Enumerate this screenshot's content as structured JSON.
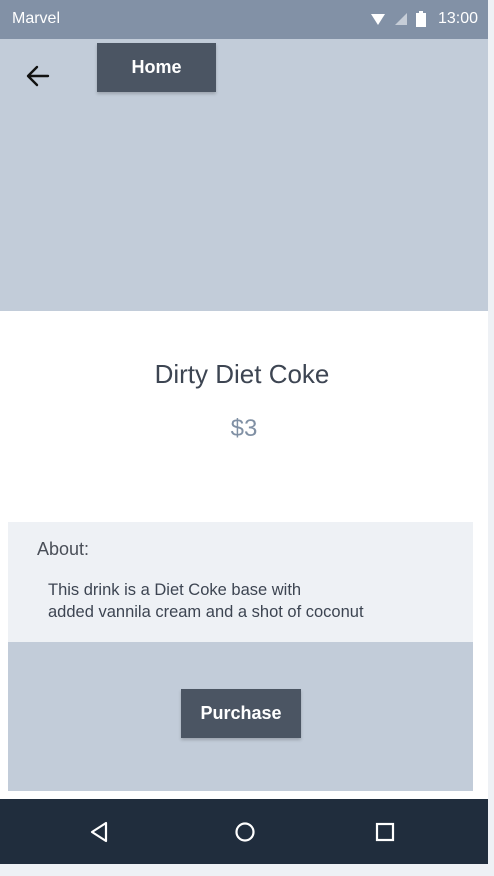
{
  "status_bar": {
    "app_name": "Marvel",
    "time": "13:00",
    "icons": [
      "wifi-icon",
      "signal-icon",
      "battery-icon"
    ]
  },
  "header": {
    "back_icon": "arrow-left-icon",
    "home_label": "Home"
  },
  "product": {
    "title": "Dirty Diet Coke",
    "price": "$3"
  },
  "about": {
    "label": "About:",
    "text": "This drink is a Diet Coke base with\n added vannila cream and a shot of coconut"
  },
  "purchase": {
    "label": "Purchase"
  },
  "nav_bar": {
    "icons": [
      "back-triangle-icon",
      "home-circle-icon",
      "recents-square-icon"
    ]
  },
  "colors": {
    "status_bar": "#8291a6",
    "hero_bg": "#c2ccd9",
    "button_bg": "#4b5563",
    "nav_bar": "#202d3d",
    "about_bg": "#eef1f5"
  }
}
